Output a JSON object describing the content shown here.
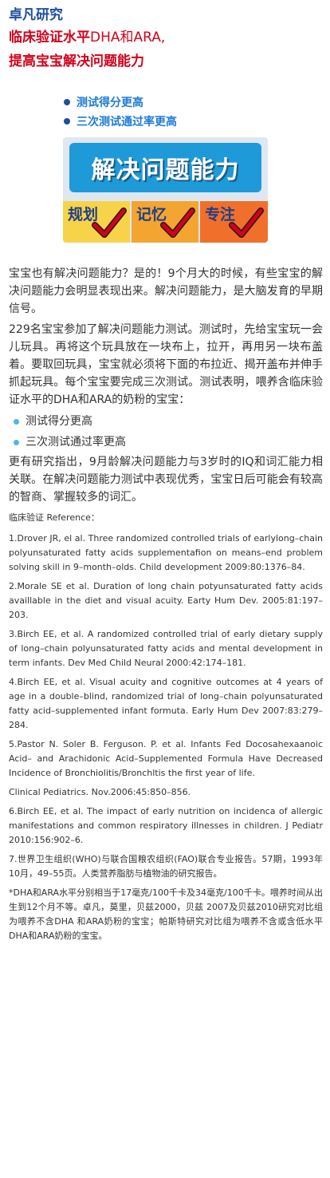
{
  "header": {
    "brand": "卓凡研究",
    "headline_line1_part1": "临床验证水平",
    "headline_line1_en": "DHA和ARA,",
    "headline_line2": "提高宝宝解决问题能力"
  },
  "top_bullets": [
    "测试得分更高",
    "三次测试通过率更高"
  ],
  "banner": {
    "title": "解决问题能力",
    "tiles": [
      "规划",
      "记忆",
      "专注"
    ]
  },
  "body": {
    "p1": "宝宝也有解决问题能力？是的！9个月大的时候，有些宝宝的解决问题能力会明显表现出来。解决问题能力，是大脑发育的早期信号。",
    "p2": "229名宝宝参加了解决问题能力测试。测试时，先给宝宝玩一会儿玩具。再将这个玩具放在一块布上，拉开，再用另一块布盖着。要取回玩具，宝宝就必须将下面的布拉近、揭开盖布并伸手抓起玩具。每个宝宝要完成三次测试。测试表明，喂养含临床验证水平的DHA和ARA的奶粉的宝宝：",
    "bullets": [
      "测试得分更高",
      "三次测试通过率更高"
    ],
    "p3": "更有研究指出，9月龄解决问题能力与3岁时的IQ和词汇能力相关联。在解决问题能力测试中表现优秀，宝宝日后可能会有较高的智商、掌握较多的词汇。"
  },
  "references": {
    "heading": "临床验证 Reference：",
    "items": [
      "1.Drover JR, el al. Three randomized controlled trials of earlylong–chain polyunsaturated fatty acids supplementafion on means–end problem solving skill in 9–month–olds. Child development 2009:80:1376–84.",
      "2.Morale SE et al. Duration of long chain potyunsaturated fatty acids availlable in the diet and visual acuity. Earty Hum Dev. 2005:81:197–203.",
      "3.Birch EE, et al. A randomized controlled trial of early dietary supply of long–chain polyunsaturated fatty acids and mental development in term infants. Dev Med Child Neural 2000:42:174–181.",
      "4.Birch EE, et al. Visual acuity and cognitive outcomes at 4 years of age in a double–blind, randomized trial of long–chain polyunsaturated fatty acid–supplemented infant formuta. Early Hum Dev 2007:83:279–284.",
      "5.Pastor N. Soler B. Ferguson. P. et al. Infants Fed Docosahexaanoic Acid– and Arachidonic Acid–Supplemented Formula Have Decreased Incidence of Bronchiolitis/Bronchltis the first year of life.",
      "Clinical Pediatrics. Nov.2006:45:850–856.",
      "6.Birch EE, et al. The impact of early nutrition on incidenca of allergic manifestations and common respiratory illnesses in children. J Pediatr 2010:156:902–6.",
      "7.世界卫生组织(WHO)与联合国粮农组织(FAO)联合专业报告。57期，1993年10月，49–55页。人类营养脂肪与植物油的研究报告。",
      "*DHA和ARA水平分别相当于17毫克/100千卡及34毫克/100千卡。喂养时间从出生到12个月不等。卓凡，莫里，贝兹2000，贝兹 2007及贝兹2010研究对比组为喂养不含DHA 和ARA奶粉的宝宝；帕斯特研究对比组为喂养不含或含低水平DHA和ARA奶粉的宝宝。"
    ]
  },
  "colors": {
    "brand": "#1f4fa0",
    "headline": "#d0021b",
    "top_bullet_text": "#1e7bd6",
    "banner_title_bg": "#1e9ad8",
    "tile1": "#f7d34a",
    "tile2": "#f4a531",
    "tile3": "#f0702b",
    "check": "#d0021b"
  },
  "icons": [
    "checkmark-icon"
  ]
}
